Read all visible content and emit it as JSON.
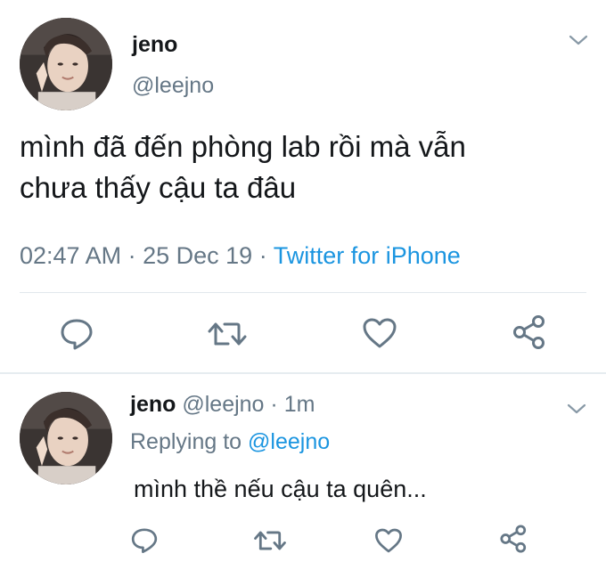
{
  "main_tweet": {
    "display_name": "jeno",
    "handle": "@leejno",
    "text_line1": "mình đã đến phòng lab rồi mà vẫn",
    "text_line2": "chưa thấy cậu ta đâu",
    "time": "02:47 AM",
    "dot1": "·",
    "date": "25 Dec 19",
    "dot2": "·",
    "source": "Twitter for iPhone"
  },
  "reply_tweet": {
    "display_name": "jeno",
    "handle": "@leejno",
    "dot": "·",
    "age": "1m",
    "replying_prefix": "Replying to",
    "replying_handle": "@leejno",
    "text": "mình thề nếu cậu ta quên..."
  },
  "icons": {
    "reply": "reply-icon",
    "retweet": "retweet-icon",
    "like": "heart-icon",
    "share": "share-icon",
    "menu": "chevron-down-icon"
  },
  "colors": {
    "accent": "#1b95e0",
    "muted": "#657786",
    "icon": "#657786"
  }
}
